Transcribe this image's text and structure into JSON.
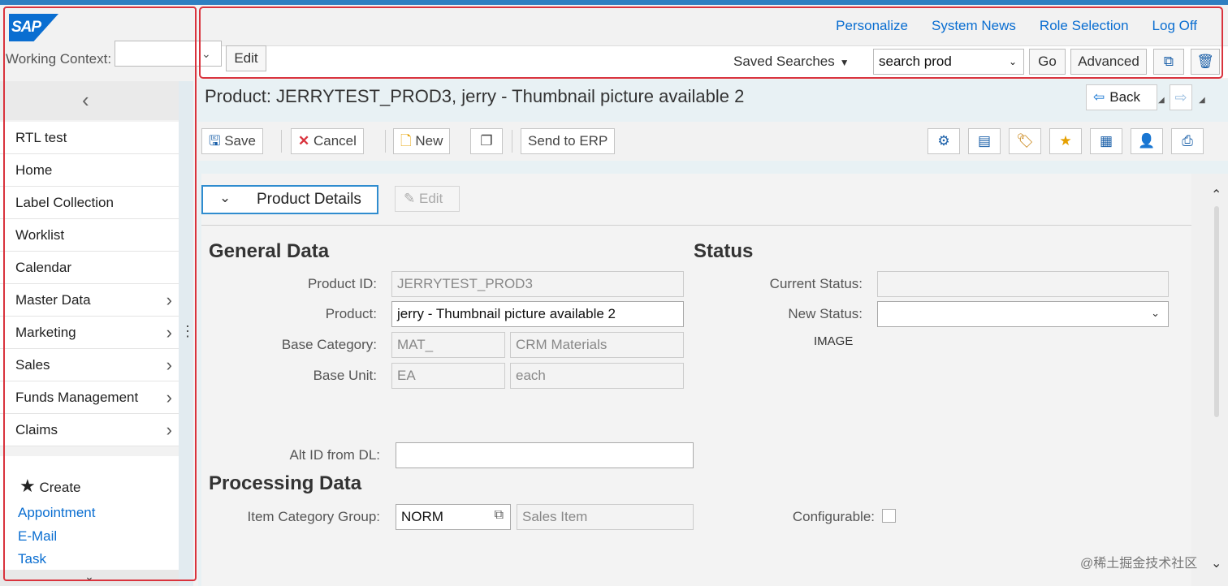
{
  "logo": {
    "text": "SAP"
  },
  "working_context": {
    "label": "Working Context:",
    "value": "",
    "edit_label": "Edit"
  },
  "nav": {
    "collapse_icon": "chevron-left-icon",
    "items": [
      {
        "label": "RTL test",
        "has_children": false
      },
      {
        "label": "Home",
        "has_children": false
      },
      {
        "label": "Label Collection",
        "has_children": false
      },
      {
        "label": "Worklist",
        "has_children": false
      },
      {
        "label": "Calendar",
        "has_children": false
      },
      {
        "label": "Master Data",
        "has_children": true
      },
      {
        "label": "Marketing",
        "has_children": true
      },
      {
        "label": "Sales",
        "has_children": true
      },
      {
        "label": "Funds Management",
        "has_children": true
      },
      {
        "label": "Claims",
        "has_children": true
      }
    ]
  },
  "create": {
    "title": "Create",
    "links": [
      "Appointment",
      "E-Mail",
      "Task"
    ]
  },
  "header_links": [
    "Personalize",
    "System News",
    "Role Selection",
    "Log Off"
  ],
  "search": {
    "saved_label": "Saved Searches",
    "selected": "search prod",
    "go_label": "Go",
    "advanced_label": "Advanced"
  },
  "page": {
    "title": "Product: JERRYTEST_PROD3, jerry - Thumbnail picture available 2",
    "back_label": "Back"
  },
  "toolbar": {
    "save_label": "Save",
    "cancel_label": "Cancel",
    "new_label": "New",
    "send_label": "Send to ERP"
  },
  "section": {
    "title": "Product Details",
    "edit_label": "Edit"
  },
  "general": {
    "title": "General Data",
    "product_id_label": "Product ID:",
    "product_id": "JERRYTEST_PROD3",
    "product_label": "Product:",
    "product": "jerry - Thumbnail picture available 2",
    "base_category_label": "Base Category:",
    "base_category_code": "MAT_",
    "base_category_text": "CRM Materials",
    "base_unit_label": "Base Unit:",
    "base_unit_code": "EA",
    "base_unit_text": "each",
    "alt_id_label": "Alt ID from DL:",
    "alt_id": ""
  },
  "status": {
    "title": "Status",
    "current_label": "Current Status:",
    "current": "",
    "new_label": "New Status:",
    "new": "",
    "image_label": "IMAGE"
  },
  "processing": {
    "title": "Processing Data",
    "icg_label": "Item Category Group:",
    "icg_code": "NORM",
    "icg_text": "Sales Item",
    "configurable_label": "Configurable:",
    "configurable": false
  },
  "watermark": "@稀土掘金技术社区"
}
